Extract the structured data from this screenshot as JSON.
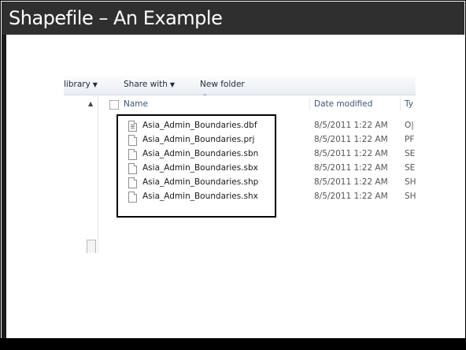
{
  "slide": {
    "title": "Shapefile – An Example"
  },
  "toolbar": {
    "library_label": "library",
    "share_label": "Share with",
    "new_folder_label": "New folder"
  },
  "columns": {
    "name": "Name",
    "date": "Date modified",
    "type": "Ty"
  },
  "files": [
    {
      "name": "Asia_Admin_Boundaries.dbf",
      "date": "8/5/2011 1:22 AM",
      "type": "O|",
      "icon": "document-icon"
    },
    {
      "name": "Asia_Admin_Boundaries.prj",
      "date": "8/5/2011 1:22 AM",
      "type": "PF",
      "icon": "blank-file-icon"
    },
    {
      "name": "Asia_Admin_Boundaries.sbn",
      "date": "8/5/2011 1:22 AM",
      "type": "SE",
      "icon": "blank-file-icon"
    },
    {
      "name": "Asia_Admin_Boundaries.sbx",
      "date": "8/5/2011 1:22 AM",
      "type": "SE",
      "icon": "blank-file-icon"
    },
    {
      "name": "Asia_Admin_Boundaries.shp",
      "date": "8/5/2011 1:22 AM",
      "type": "SH",
      "icon": "blank-file-icon"
    },
    {
      "name": "Asia_Admin_Boundaries.shx",
      "date": "8/5/2011 1:22 AM",
      "type": "SH",
      "icon": "blank-file-icon"
    }
  ],
  "colors": {
    "title_bar": "#2f2f2f",
    "highlight_border": "#000000"
  }
}
